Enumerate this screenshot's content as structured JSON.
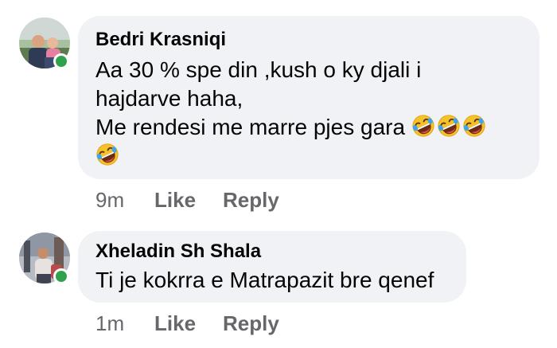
{
  "comments": [
    {
      "author": "Bedri Krasniqi",
      "lines": [
        "Aa 30 % spe din ,kush o ky djali i",
        "hajdarve haha,",
        "Me rendesi me marre pjes gara"
      ],
      "emojis": [
        "rolling-on-floor-laughing",
        "rolling-on-floor-laughing",
        "rolling-on-floor-laughing",
        "rolling-on-floor-laughing"
      ],
      "time": "9m",
      "like_label": "Like",
      "reply_label": "Reply",
      "online": true
    },
    {
      "author": "Xheladin Sh Shala",
      "lines": [
        "Ti je kokrra e Matrapazit bre qenef"
      ],
      "time": "1m",
      "like_label": "Like",
      "reply_label": "Reply",
      "online": true
    }
  ],
  "colors": {
    "bubble": "#f0f2f5",
    "online": "#31a24c",
    "meta": "#65676b"
  }
}
